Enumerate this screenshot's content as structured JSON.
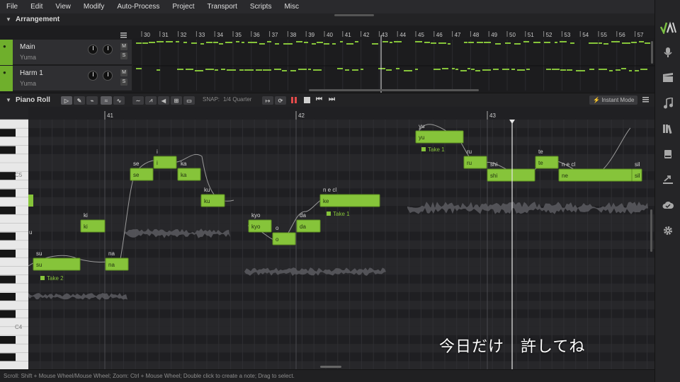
{
  "menu": [
    "File",
    "Edit",
    "View",
    "Modify",
    "Auto-Process",
    "Project",
    "Transport",
    "Scripts",
    "Misc"
  ],
  "arrangement": {
    "title": "Arrangement",
    "ruler": [
      "30",
      "31",
      "32",
      "33",
      "34",
      "35",
      "36",
      "37",
      "38",
      "39",
      "40",
      "41",
      "42",
      "43",
      "44",
      "45",
      "46",
      "47",
      "48",
      "49",
      "50",
      "51",
      "52",
      "53",
      "54",
      "55",
      "56",
      "57"
    ],
    "tracks": [
      {
        "name": "Main",
        "singer": "Yuma",
        "mute": "M",
        "solo": "S"
      },
      {
        "name": "Harm 1",
        "singer": "Yuma",
        "mute": "M",
        "solo": "S"
      }
    ]
  },
  "piano_roll": {
    "title": "Piano Roll",
    "snap_label": "SNAP:",
    "snap_value": "1/4 Quarter",
    "instant_mode": "Instant Mode",
    "bar_labels": [
      "41",
      "42",
      "43"
    ],
    "key_labels": [
      "C5",
      "C4"
    ],
    "notes": [
      {
        "lyric": "su",
        "phoneme": "su"
      },
      {
        "lyric": "ki",
        "phoneme": "ki"
      },
      {
        "lyric": "na",
        "phoneme": "na"
      },
      {
        "lyric": "se",
        "phoneme": "se"
      },
      {
        "lyric": "i",
        "phoneme": "i"
      },
      {
        "lyric": "ka",
        "phoneme": "ka"
      },
      {
        "lyric": "ku",
        "phoneme": "ku"
      },
      {
        "lyric": "kyo",
        "phoneme": "kyo"
      },
      {
        "lyric": "o",
        "phoneme": "o"
      },
      {
        "lyric": "da",
        "phoneme": "da"
      },
      {
        "lyric": "ke",
        "phoneme": "n e cl"
      },
      {
        "lyric": "yu",
        "phoneme": "yu"
      },
      {
        "lyric": "ru",
        "phoneme": "ru"
      },
      {
        "lyric": "shi",
        "phoneme": "shi"
      },
      {
        "lyric": "te",
        "phoneme": "te"
      },
      {
        "lyric": "ne",
        "phoneme": "n e cl"
      },
      {
        "lyric": "sil",
        "phoneme": "sil"
      }
    ],
    "take_labels": [
      "Take 2",
      "Take 1",
      "Take 1"
    ],
    "edge_note_label": "u"
  },
  "subtitle": "今日だけ　許してね",
  "status": "Scroll: Shift + Mouse Wheel/Mouse Wheel; Zoom: Ctrl + Mouse Wheel; Double click to create a note; Drag to select.",
  "colors": {
    "note": "#86c43a",
    "track": "#6faf2c",
    "bg": "#1b1b1d"
  }
}
